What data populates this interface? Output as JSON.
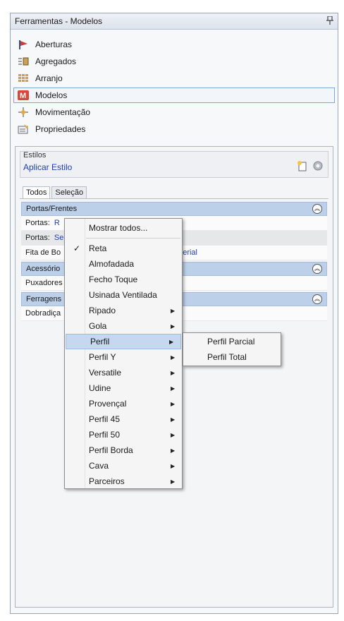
{
  "window": {
    "title": "Ferramentas - Modelos",
    "pin_icon": "pin-icon"
  },
  "nav": [
    {
      "label": "Aberturas",
      "icon": "flag-icon",
      "selected": false
    },
    {
      "label": "Agregados",
      "icon": "aggregate-icon",
      "selected": false
    },
    {
      "label": "Arranjo",
      "icon": "grid-icon",
      "selected": false
    },
    {
      "label": "Modelos",
      "icon": "models-icon",
      "selected": true
    },
    {
      "label": "Movimentação",
      "icon": "move-icon",
      "selected": false
    },
    {
      "label": "Propriedades",
      "icon": "properties-icon",
      "selected": false
    }
  ],
  "estilos": {
    "caption": "Estilos",
    "link": "Aplicar Estilo"
  },
  "tabs": [
    {
      "label": "Todos",
      "active": true
    },
    {
      "label": "Seleção",
      "active": false
    }
  ],
  "groups": [
    {
      "title": "Portas/Frentes",
      "rows": [
        {
          "label": "Portas:",
          "value": "R"
        },
        {
          "label": "Portas:",
          "value": "Se"
        },
        {
          "label": "Fita de Bo",
          "value": "terial"
        }
      ]
    },
    {
      "title": "Acessório",
      "rows": [
        {
          "label": "Puxadores",
          "value": ""
        }
      ]
    },
    {
      "title": "Ferragens",
      "rows": [
        {
          "label": "Dobradiça",
          "value": ""
        }
      ]
    }
  ],
  "context_menu": {
    "top_item": "Mostrar todos...",
    "items": [
      {
        "label": "Reta",
        "checked": true,
        "submenu": false
      },
      {
        "label": "Almofadada",
        "checked": false,
        "submenu": false
      },
      {
        "label": "Fecho Toque",
        "checked": false,
        "submenu": false
      },
      {
        "label": "Usinada Ventilada",
        "checked": false,
        "submenu": false
      },
      {
        "label": "Ripado",
        "checked": false,
        "submenu": true
      },
      {
        "label": "Gola",
        "checked": false,
        "submenu": true
      },
      {
        "label": "Perfil",
        "checked": false,
        "submenu": true,
        "highlighted": true
      },
      {
        "label": "Perfil Y",
        "checked": false,
        "submenu": true
      },
      {
        "label": "Versatile",
        "checked": false,
        "submenu": true
      },
      {
        "label": "Udine",
        "checked": false,
        "submenu": true
      },
      {
        "label": "Provençal",
        "checked": false,
        "submenu": true
      },
      {
        "label": "Perfil 45",
        "checked": false,
        "submenu": true
      },
      {
        "label": "Perfil 50",
        "checked": false,
        "submenu": true
      },
      {
        "label": "Perfil Borda",
        "checked": false,
        "submenu": true
      },
      {
        "label": "Cava",
        "checked": false,
        "submenu": true
      },
      {
        "label": "Parceiros",
        "checked": false,
        "submenu": true
      }
    ]
  },
  "submenu": {
    "items": [
      "Perfil Parcial",
      "Perfil Total"
    ]
  },
  "colors": {
    "accent": "#1f3fb0",
    "group_header": "#bcd0e9",
    "highlight": "#c5d8ef"
  }
}
